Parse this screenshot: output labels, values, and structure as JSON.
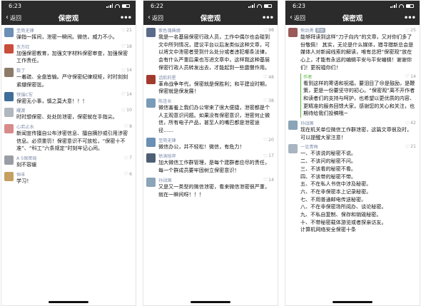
{
  "phones": [
    {
      "time": "6:23",
      "back_label": "返回",
      "title": "保密观",
      "more_label": "•••",
      "comments": [
        {
          "nick": "至简无锋",
          "likes": "21",
          "avatar_color": "#6b8fb5",
          "text": "弹指一挥间，泄密一瞬间。微信，威力不小。"
        },
        {
          "nick": "东方红",
          "likes": "18",
          "avatar_color": "#c94d3a",
          "text": "加强保密教育，加强文字材料保密审查，加强保密工作责任。"
        },
        {
          "nick": "数了",
          "likes": "14",
          "avatar_color": "#8c7b6b",
          "text": "一着疏、全盘皆输。严守保密纪律规矩，时时刻刻紧绷保密弦。"
        },
        {
          "nick": "铁锚C军",
          "likes": "14",
          "avatar_color": "#3f6e9a",
          "text": "保密无小事，慎之莫大意！！！"
        },
        {
          "nick": "耀渡",
          "likes": "10",
          "avatar_color": "#b0b7bf",
          "text": "时时想保密、处处防泄密，保密就在手指尖。"
        },
        {
          "nick": "心若止水",
          "likes": "8",
          "avatar_color": "#d98a8a",
          "text": "新闻宣传擅自公布涉密信息、擅自摘抄或引用涉密信息。必须重罚！保密意识不可放松，“保密十不准”、“科工”六条规定”时刻牢记心间。"
        },
        {
          "nick": "A 5保密局",
          "likes": "7",
          "avatar_color": "#9a9ea4",
          "text": "刻不容缓"
        },
        {
          "nick": "恒丰",
          "likes": "6",
          "avatar_color": "#c6a060",
          "text": "学习！"
        }
      ]
    },
    {
      "time": "6:22",
      "back_label": "返回",
      "title": "保密观",
      "more_label": "•••",
      "comments": [
        {
          "nick": "紫色蒲典娜",
          "likes": "98",
          "avatar_color": "#5b6b8a",
          "text": "我是一名基层保密行政人员，工作中偶尔也会碰到文中所列情况，建议平台以后发类似这种文章，可以将文中泄密者受到什么处分或者违犯哪条法律，会有什么严重后果也写进文章中，这样我这种基层保密行政人员转发出去，才能起到一些震慑作用。"
        },
        {
          "nick": "话航的星",
          "likes": "48",
          "avatar_color": "#a23b2e",
          "text": "革命战争年代，保密就是保胜利；和平建设时期，保密就是保发展！"
        },
        {
          "nick": "陈连长",
          "likes": "38",
          "avatar_color": "#7a9bb8",
          "text": "微信害羞上我们办公常来了很大便捷，泄密都是个人主观意识问题。如果没有保密意识，泄密何止微信，所有电子产品，甚至人的嘴巴都是泄密途径……"
        },
        {
          "nick": "至简无锋",
          "likes": "20",
          "avatar_color": "#6b8fb5",
          "text": "微信办公，并不轻松！微信，有危力！"
        },
        {
          "nick": "徐涛拍岸",
          "likes": "17",
          "avatar_color": "#4d5f74",
          "text": "加大微信工作群管理，是每个建群者应尽的责任，每一个群成员要牢固树立保密意识！"
        },
        {
          "nick": "孙战国",
          "likes": "14",
          "avatar_color": "#8aa4b8",
          "text": "又是又一类型的微信泄密，看来微信泄密很严重，就在一瞬间呀！！！"
        }
      ]
    },
    {
      "time": "6:23",
      "back_label": "返回",
      "title": "保密观",
      "more_label": "•••",
      "comments": [
        {
          "nick": "熊剑勇",
          "badge": "原创",
          "likes": "25",
          "avatar_color": "#9a5a5a",
          "text": "能够拜读到这样“刀子向内”的文章，又对你们多了份敬佩！ 其实，无论是什么媒体，猎寻猎新总会是媒体人对新闻线索的解读，唯有总把“保密观”放在心上，才能有永远的编辑平安与平安编辑！谢谢你们！更祝福你们！",
          "reply": {
            "author": "作者",
            "likes": "14",
            "text": "看到这样的寄语和祝福，要泪目了😢是鼓励，是鞭策，更是一份要坚守的初心。“保密观”离不开作者和读者们的支持与呵护，也希望以更优质的内容、更精准的服务回馈大家，感谢您的关心和关注，也期待给我们投稿哦~"
          }
        },
        {
          "nick": "孙战国",
          "likes": "42",
          "avatar_color": "#8aa4b8",
          "text": "现在机关单位微信工作群泄密，这篇文章很及时，可以提醒大家注意！"
        },
        {
          "nick": "一见青梅",
          "likes": "21",
          "avatar_color": "#a9b4c2",
          "text": "一、不该说的秘密不说。\n二、不该问的秘密不问。\n三、不该看的秘密不看。\n四、不该带的秘密不带。\n五、不在私人书信中涉及秘密。\n六、不在非保密本上记录秘密。\n七、不用普通邮电传送秘密。\n八、不在非保密场所阅办、谈论秘密。\n九、不私自复制、保存和销毁秘密。\n十、不带秘密载体游览或者探亲访友。\n计算机网络安全保密十条"
        }
      ]
    }
  ]
}
